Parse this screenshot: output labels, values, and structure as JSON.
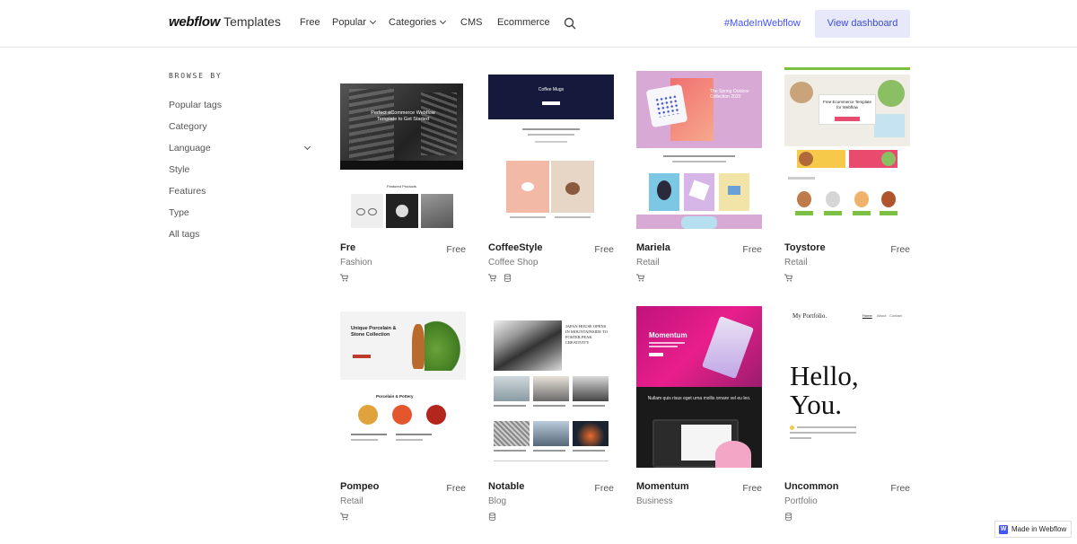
{
  "header": {
    "logo_brand": "webflow",
    "logo_suffix": "Templates",
    "nav": [
      {
        "label": "Free"
      },
      {
        "label": "Popular"
      },
      {
        "label": "Categories"
      },
      {
        "label": "CMS"
      },
      {
        "label": "Ecommerce"
      }
    ],
    "tag_link": "#MadeInWebflow",
    "dashboard_button": "View dashboard"
  },
  "sidebar": {
    "title": "BROWSE BY",
    "items": [
      {
        "label": "Popular tags"
      },
      {
        "label": "Category"
      },
      {
        "label": "Language"
      },
      {
        "label": "Style"
      },
      {
        "label": "Features"
      },
      {
        "label": "Type"
      },
      {
        "label": "All tags"
      }
    ]
  },
  "cards": [
    {
      "name": "Fre",
      "price": "Free",
      "category": "Fashion",
      "icons": [
        "cart-icon"
      ],
      "thumb_text": {
        "hero": "Perfect eCommerce Webflow Template to Get Started",
        "sub": "Featured Products"
      }
    },
    {
      "name": "CoffeeStyle",
      "price": "Free",
      "category": "Coffee Shop",
      "icons": [
        "cart-icon",
        "cms-icon"
      ],
      "thumb_text": {
        "hero": "Coffee Mugs"
      }
    },
    {
      "name": "Mariela",
      "price": "Free",
      "category": "Retail",
      "icons": [
        "cart-icon"
      ],
      "thumb_text": {
        "hero": "The Spring Outdoor Collection 2020"
      }
    },
    {
      "name": "Toystore",
      "price": "Free",
      "category": "Retail",
      "icons": [
        "cart-icon"
      ],
      "thumb_text": {
        "hero": "Free Ecommerce Template for Webflow"
      }
    },
    {
      "name": "Pompeo",
      "price": "Free",
      "category": "Retail",
      "icons": [
        "cart-icon"
      ],
      "thumb_text": {
        "hero": "Unique Porcelain & Stone Collection",
        "sub": "Porcelain & Pottery"
      }
    },
    {
      "name": "Notable",
      "price": "Free",
      "category": "Blog",
      "icons": [
        "cms-icon"
      ],
      "thumb_text": {
        "hero": "JAPAN HOUSE OPENS IN MOUNTAINSIDE TO FOSTER PEAK CREATIVITY"
      }
    },
    {
      "name": "Momentum",
      "price": "Free",
      "category": "Business",
      "icons": [],
      "thumb_text": {
        "hero": "Momentum",
        "sub": "Nullam quis risus eget urna mollis ornare vel eu leo."
      }
    },
    {
      "name": "Uncommon",
      "price": "Free",
      "category": "Portfolio",
      "icons": [
        "cms-icon"
      ],
      "thumb_text": {
        "hero": "My Portfolio.",
        "big1": "Hello,",
        "big2": "You.",
        "nav": [
          "Home",
          "About",
          "Contact"
        ]
      }
    }
  ],
  "badge": "Made in Webflow"
}
